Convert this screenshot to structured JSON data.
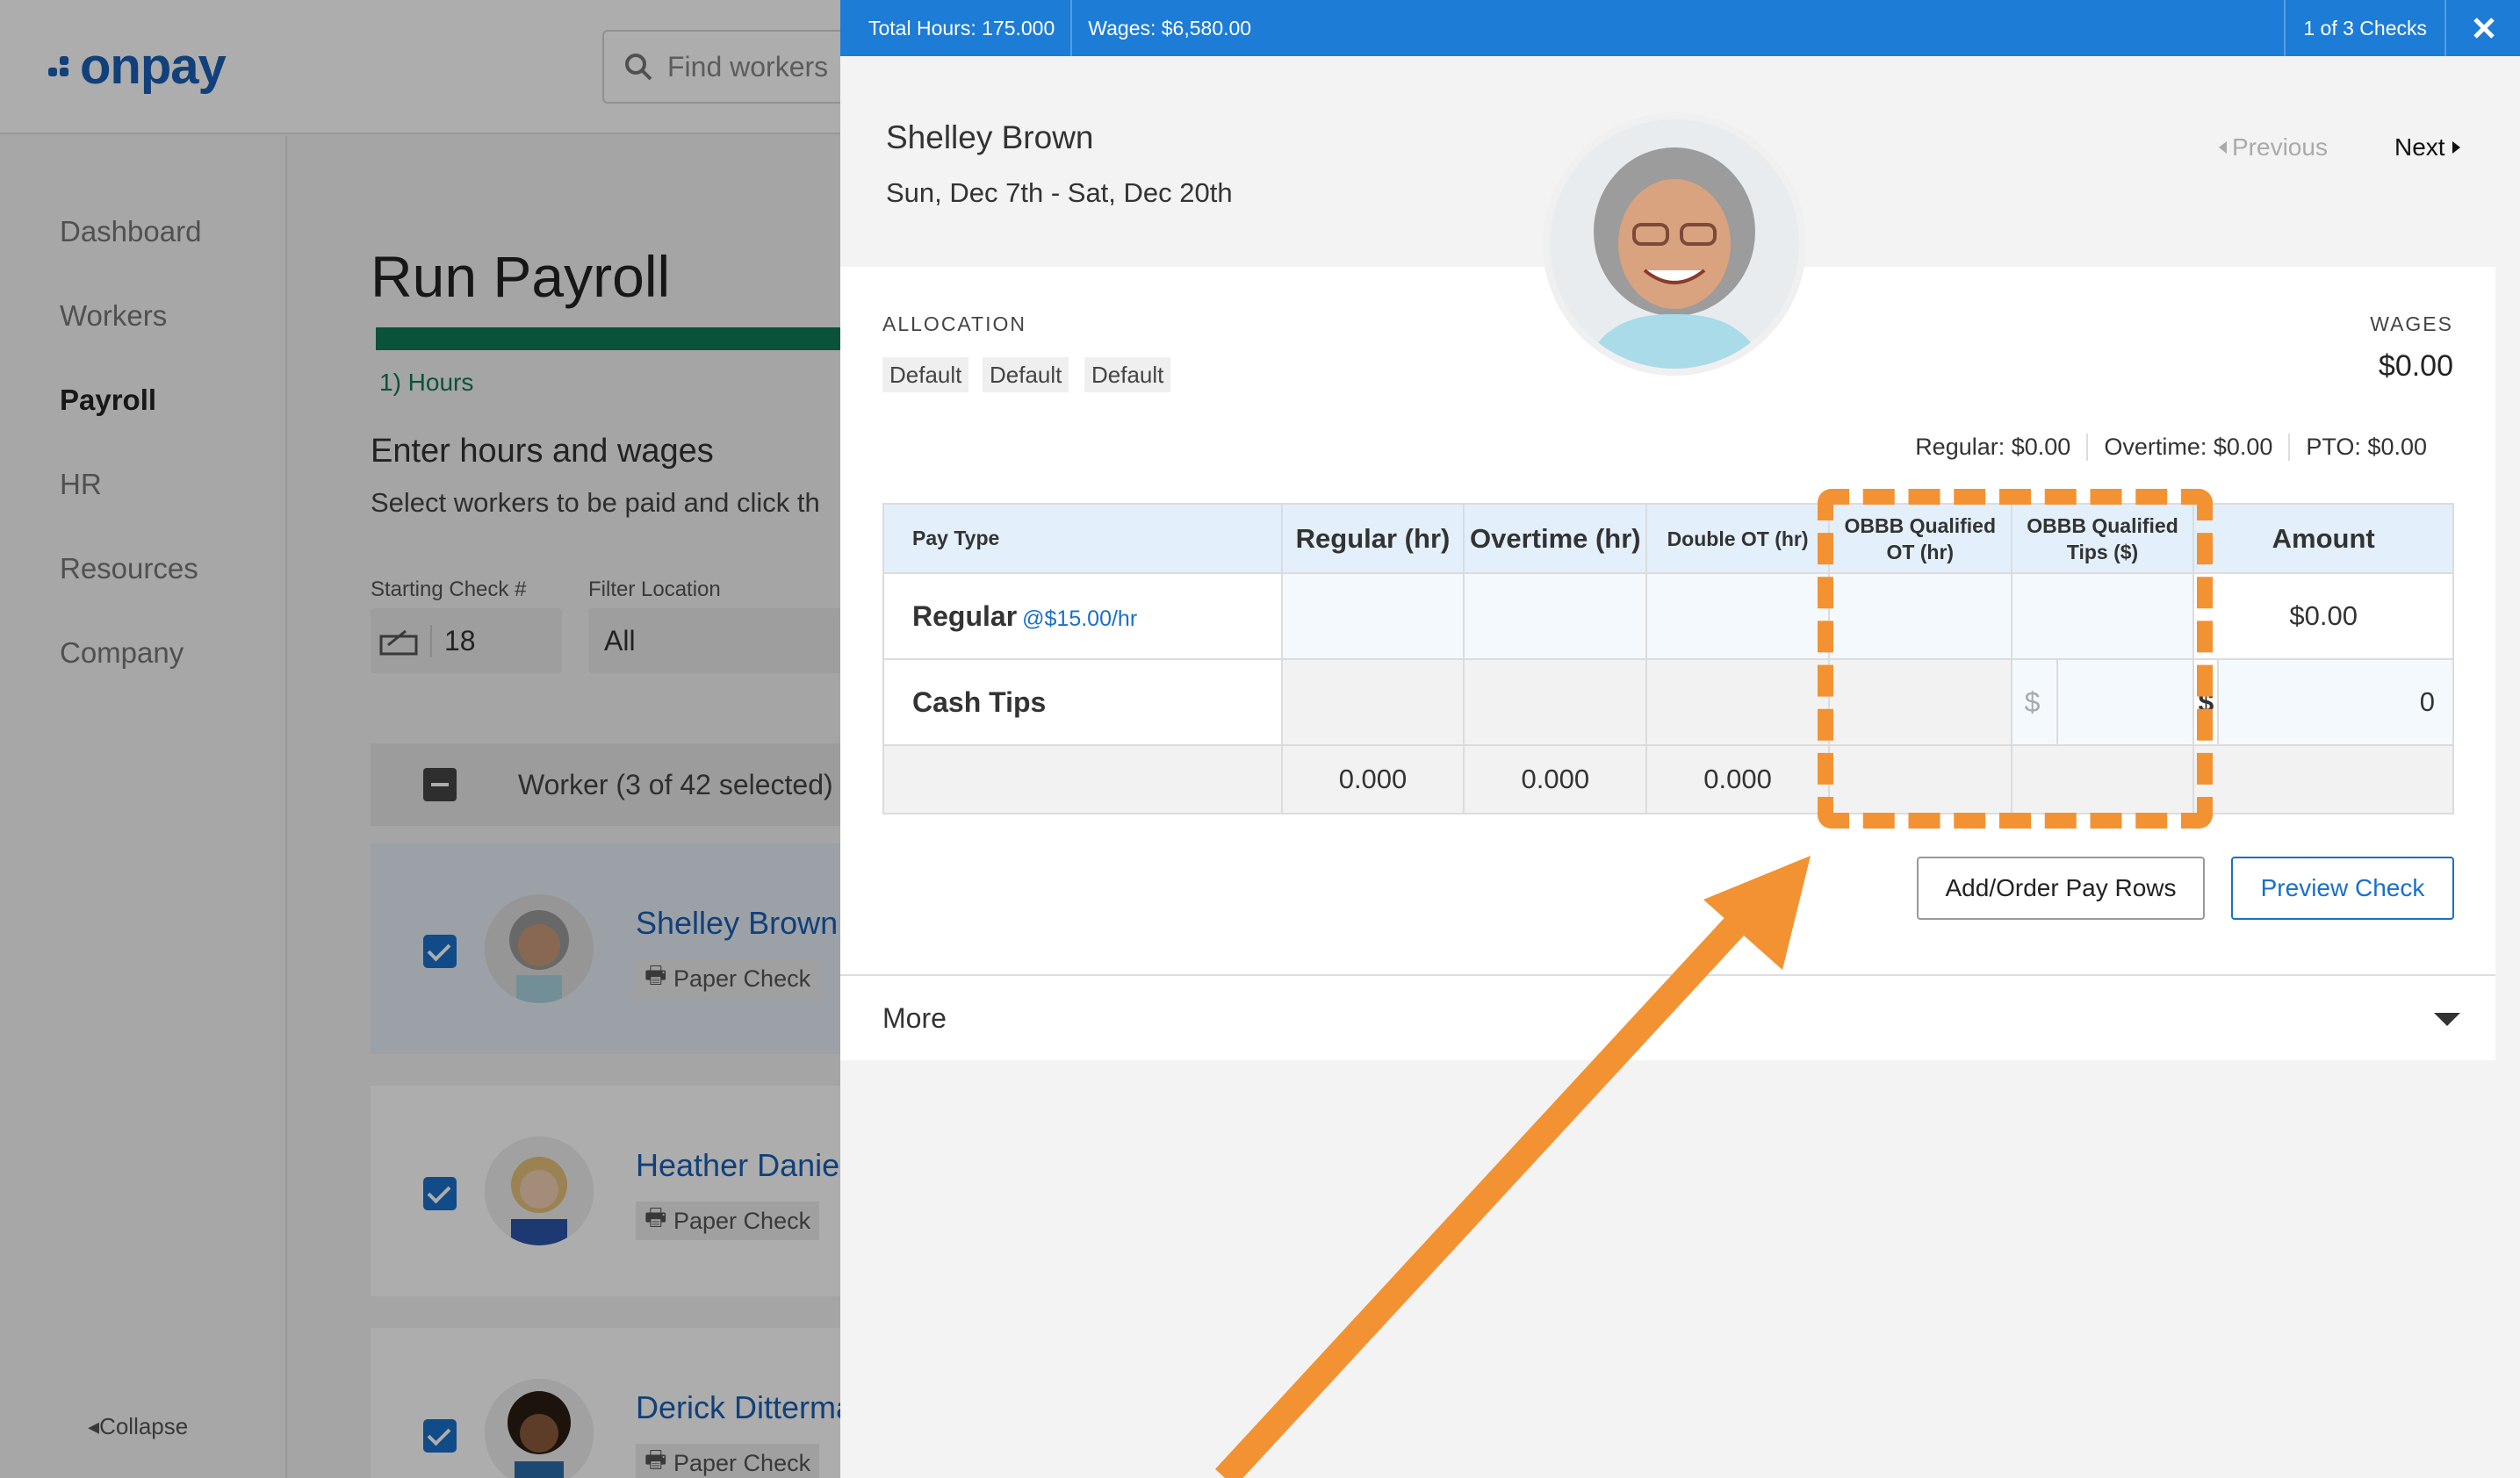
{
  "app": {
    "logo_text": "onpay",
    "search_placeholder": "Find workers",
    "sidebar": {
      "items": [
        {
          "label": "Dashboard"
        },
        {
          "label": "Workers"
        },
        {
          "label": "Payroll",
          "active": true
        },
        {
          "label": "HR"
        },
        {
          "label": "Resources"
        },
        {
          "label": "Company"
        }
      ],
      "collapse_label": "Collapse"
    },
    "main": {
      "title": "Run Payroll",
      "step_label": "1) Hours",
      "subtitle": "Enter hours and wages",
      "instructions": "Select workers to be paid and click th",
      "starting_check_label": "Starting Check #",
      "starting_check_value": "18",
      "filter_location_label": "Filter Location",
      "filter_location_value": "All",
      "worker_header": "Worker (3 of 42 selected)",
      "workers": [
        {
          "name": "Shelley Brown",
          "method": "Paper Check"
        },
        {
          "name": "Heather Daniel",
          "method": "Paper Check"
        },
        {
          "name": "Derick Ditterma",
          "method": "Paper Check"
        }
      ]
    }
  },
  "panel": {
    "topbar": {
      "total_hours": "Total Hours: 175.000",
      "wages": "Wages: $6,580.00",
      "checks": "1 of 3 Checks"
    },
    "employee_name": "Shelley Brown",
    "period": "Sun, Dec 7th - Sat, Dec 20th",
    "prev_label": "Previous",
    "next_label": "Next",
    "allocation_label": "ALLOCATION",
    "allocation_tags": [
      "Default",
      "Default",
      "Default"
    ],
    "wages_label": "WAGES",
    "wages_value": "$0.00",
    "breakdown": {
      "regular": "Regular: $0.00",
      "overtime": "Overtime: $0.00",
      "pto": "PTO: $0.00"
    },
    "table": {
      "headers": {
        "pay_type": "Pay Type",
        "regular": "Regular (hr)",
        "overtime": "Overtime (hr)",
        "double_ot": "Double OT (hr)",
        "obbb_ot": "OBBB Qualified OT (hr)",
        "obbb_tips": "OBBB Qualified Tips ($)",
        "amount": "Amount"
      },
      "rows": [
        {
          "label": "Regular",
          "rate": "@$15.00/hr",
          "amount": "$0.00"
        },
        {
          "label": "Cash Tips",
          "dollar": "$",
          "amount_dollar": "$",
          "amount": "0"
        }
      ],
      "totals": {
        "regular": "0.000",
        "overtime": "0.000",
        "double_ot": "0.000"
      }
    },
    "buttons": {
      "add_rows": "Add/Order Pay Rows",
      "preview": "Preview Check"
    },
    "more_label": "More"
  },
  "colors": {
    "brand_blue": "#1a5fb4",
    "topbar_blue": "#1d7cd6",
    "progress_green": "#0f7a55",
    "annotation_orange": "#f39232"
  }
}
